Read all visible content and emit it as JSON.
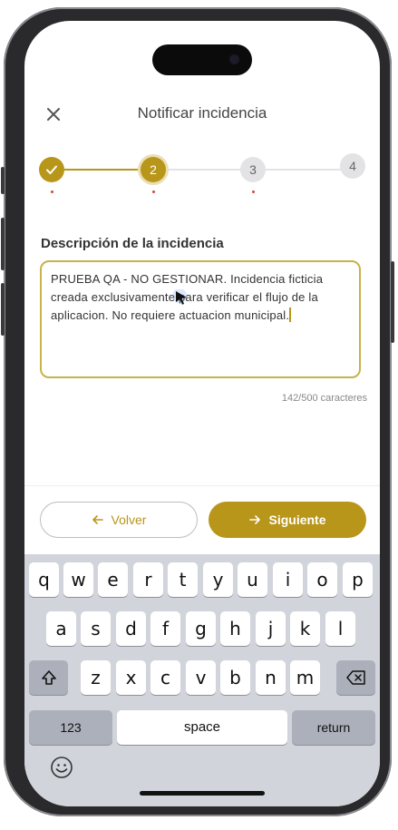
{
  "header": {
    "title": "Notificar incidencia",
    "close_icon": "close-icon"
  },
  "stepper": {
    "steps": [
      {
        "label": "",
        "state": "done"
      },
      {
        "label": "2",
        "state": "active"
      },
      {
        "label": "3",
        "state": "todo"
      },
      {
        "label": "4",
        "state": "todo"
      }
    ],
    "progress_fraction": 0.25
  },
  "form": {
    "description_label": "Descripción de la incidencia",
    "description_value": "PRUEBA QA - NO GESTIONAR. Incidencia ficticia creada exclusivamente para verificar el flujo de la aplicacion. No requiere actuacion municipal.",
    "char_counter": "142/500 caracteres"
  },
  "actions": {
    "back_label": "Volver",
    "next_label": "Siguiente"
  },
  "keyboard": {
    "row1": [
      "q",
      "w",
      "e",
      "r",
      "t",
      "y",
      "u",
      "i",
      "o",
      "p"
    ],
    "row2": [
      "a",
      "s",
      "d",
      "f",
      "g",
      "h",
      "j",
      "k",
      "l"
    ],
    "row3": [
      "z",
      "x",
      "c",
      "v",
      "b",
      "n",
      "m"
    ],
    "numbers_label": "123",
    "space_label": "space",
    "return_label": "return"
  },
  "colors": {
    "accent": "#b8961a",
    "accent_light": "#eadfb3",
    "error_dot": "#d0453f",
    "keyboard_bg": "#d1d4db"
  }
}
